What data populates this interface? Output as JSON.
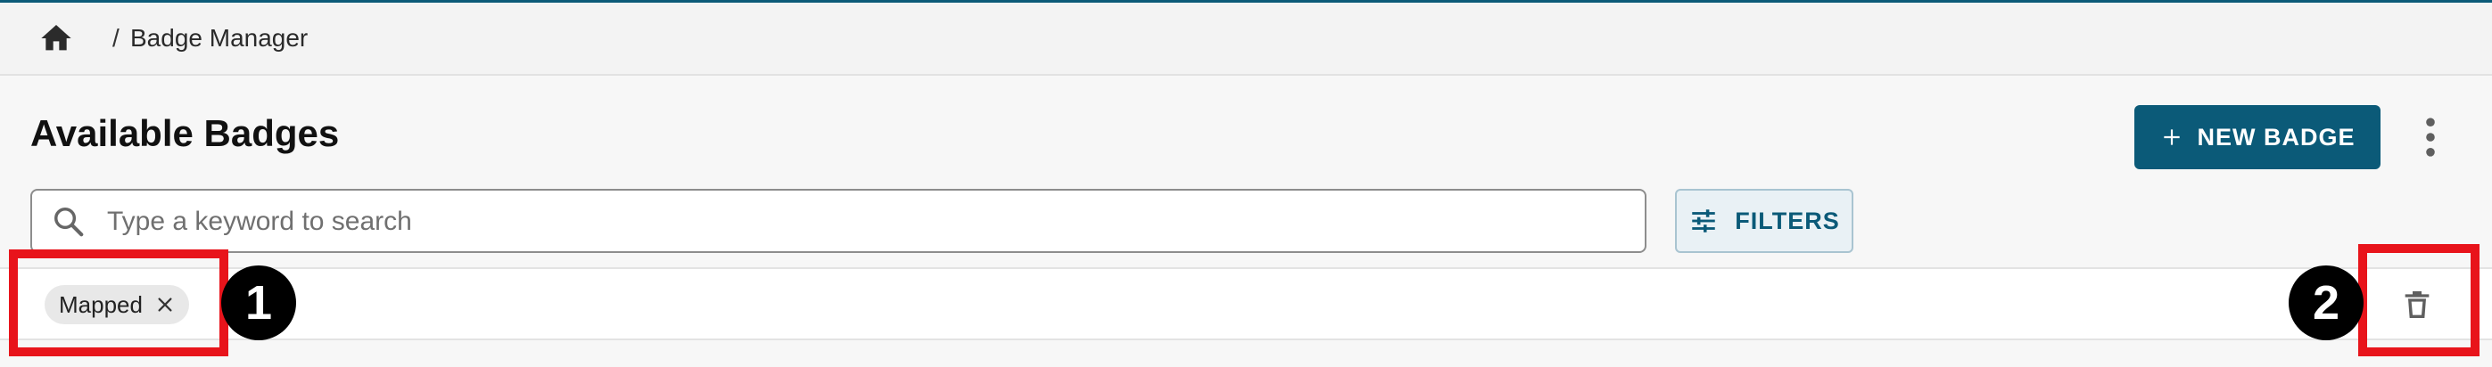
{
  "breadcrumb": {
    "home_icon": "home-icon",
    "separator": "/",
    "current": "Badge Manager"
  },
  "page": {
    "title": "Available Badges"
  },
  "actions": {
    "new_badge_label": "NEW BADGE",
    "new_badge_icon": "plus-icon",
    "more_icon": "more-vertical-icon"
  },
  "search": {
    "placeholder": "Type a keyword to search",
    "value": ""
  },
  "filters": {
    "label": "FILTERS",
    "icon": "sliders-icon"
  },
  "active_filters": [
    {
      "label": "Mapped"
    }
  ],
  "clear_filters_icon": "trash-icon",
  "annotations": [
    {
      "label": "1"
    },
    {
      "label": "2"
    }
  ],
  "colors": {
    "brand": "#0b5a78",
    "annotation": "#e8141b"
  }
}
